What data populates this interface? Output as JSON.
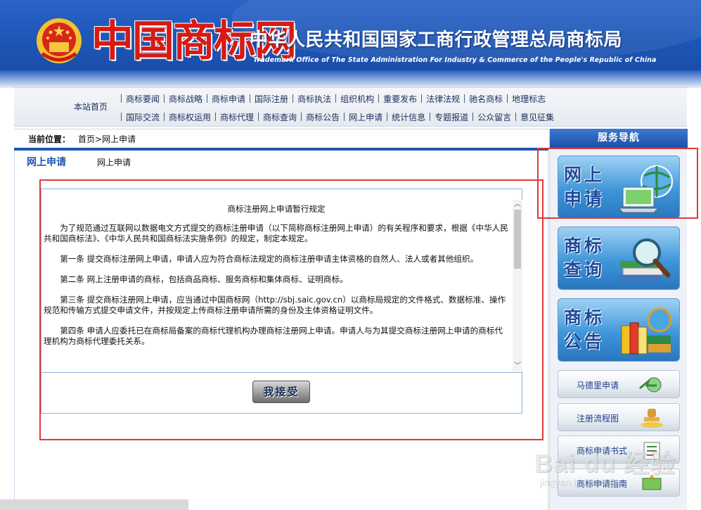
{
  "header": {
    "logo_text": "中国商标网",
    "org_title": "中华人民共和国国家工商行政管理总局商标局",
    "org_subtitle": "Trademark Office of The State Administration For Industry & Commerce of the People's Republic of China"
  },
  "nav": {
    "home": "本站首页",
    "row1": [
      "商标要闻",
      "商标战略",
      "商标申请",
      "国际注册",
      "商标执法",
      "组织机构",
      "重要发布",
      "法律法规",
      "驰名商标",
      "地理标志"
    ],
    "row2": [
      "国际交流",
      "商标权运用",
      "商标代理",
      "商标查询",
      "商标公告",
      "网上申请",
      "统计信息",
      "专题报道",
      "公众留言",
      "意见征集"
    ]
  },
  "breadcrumb": {
    "label": "当前位置：",
    "path": "首页>网上申请"
  },
  "section": {
    "title": "网上申请",
    "subtitle": "网上申请"
  },
  "agreement": {
    "title": "商标注册网上申请暂行规定",
    "paragraphs": [
      "为了规范通过互联网以数据电文方式提交的商标注册申请（以下简称商标注册网上申请）的有关程序和要求，根据《中华人民共和国商标法》、《中华人民共和国商标法实施条例》的规定，制定本规定。",
      "第一条  提交商标注册网上申请，申请人应为符合商标法规定的商标注册申请主体资格的自然人、法人或者其他组织。",
      "第二条  网上注册申请的商标，包括商品商标、服务商标和集体商标、证明商标。",
      "第三条  提交商标注册网上申请，应当通过中国商标网（http://sbj.saic.gov.cn）以商标局规定的文件格式、数据标准、操作规范和传输方式提交申请文件，并按规定上传商标注册申请所需的身份及主体资格证明文件。",
      "第四条  申请人应委托已在商标局备案的商标代理机构办理商标注册网上申请。申请人与为其提交商标注册网上申请的商标代理机构为商标代理委托关系。"
    ],
    "accept_label": "我接受"
  },
  "sidebar": {
    "heading": "服务导航",
    "tiles": [
      {
        "label": "网上申请",
        "icon": "laptop-globe-icon"
      },
      {
        "label": "商标查询",
        "icon": "magnifier-books-icon"
      },
      {
        "label": "商标公告",
        "icon": "books-globe-icon"
      }
    ],
    "buttons": [
      {
        "label": "马德里申请",
        "icon": "globe-arrow-icon"
      },
      {
        "label": "注册流程图",
        "icon": "stamp-icon"
      },
      {
        "label": "商标申请书式",
        "icon": "document-icon"
      },
      {
        "label": "商标申请指南",
        "icon": "guide-book-icon"
      }
    ]
  },
  "watermark": {
    "brand": "Bai du 经验",
    "url": "jingyan.baidu.com"
  },
  "colors": {
    "banner_blue": "#1d56b7",
    "logo_red": "#d81a12",
    "section_blue": "#1e56b2",
    "highlight_red": "#e0393b"
  }
}
